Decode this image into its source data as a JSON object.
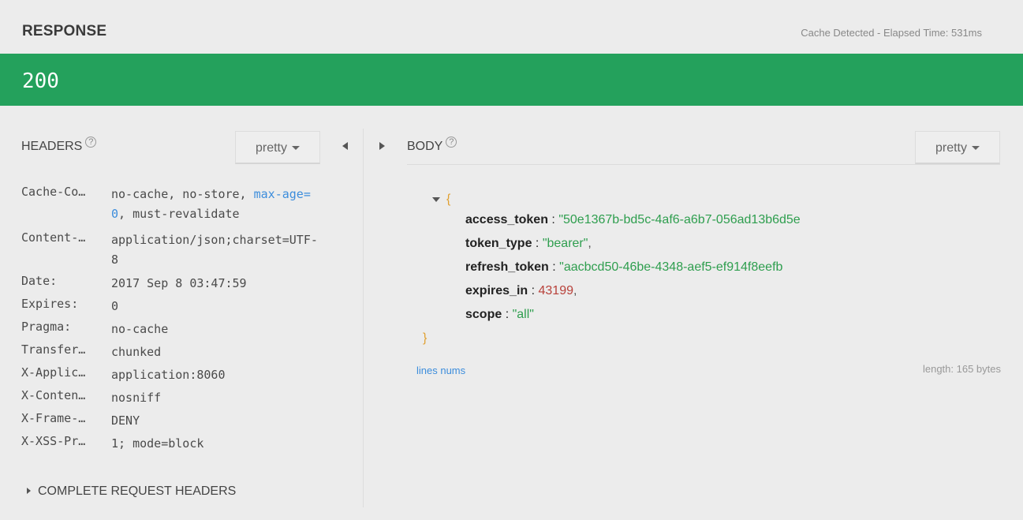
{
  "response": {
    "title": "RESPONSE",
    "cache_info": "Cache Detected - Elapsed Time: 531ms",
    "status_code": "200",
    "status_color": "#24a15c"
  },
  "headers_panel": {
    "title": "HEADERS",
    "help_icon": "?",
    "format": "pretty",
    "rows": [
      {
        "key": "Cache-Co…",
        "value": "no-cache, no-store, ",
        "value_blue": "max-age=0",
        "value_tail": ", must-revalidate"
      },
      {
        "key": "Content-…",
        "value": "application/json;charset=UTF-8"
      },
      {
        "key": "Date:",
        "value": "2017 Sep 8 03:47:59"
      },
      {
        "key": "Expires:",
        "value": "0"
      },
      {
        "key": "Pragma:",
        "value": "no-cache"
      },
      {
        "key": "Transfer…",
        "value": "chunked"
      },
      {
        "key": "X-Applic…",
        "value": "application:8060"
      },
      {
        "key": "X-Conten…",
        "value": "nosniff"
      },
      {
        "key": "X-Frame-…",
        "value": "DENY"
      },
      {
        "key": "X-XSS-Pr…",
        "value": "1; mode=block"
      }
    ],
    "complete_request_headers": "COMPLETE REQUEST HEADERS"
  },
  "body_panel": {
    "title": "BODY",
    "help_icon": "?",
    "format": "pretty",
    "open_brace": "{",
    "close_brace": "}",
    "fields": [
      {
        "key": "access_token",
        "value": "\"50e1367b-bd5c-4af6-a6b7-056ad13b6d5e",
        "type": "string"
      },
      {
        "key": "token_type",
        "value": "\"bearer\"",
        "type": "string",
        "comma": ","
      },
      {
        "key": "refresh_token",
        "value": "\"aacbcd50-46be-4348-aef5-ef914f8eefb",
        "type": "string"
      },
      {
        "key": "expires_in",
        "value": "43199",
        "type": "number",
        "comma": ","
      },
      {
        "key": "scope",
        "value": "\"all\"",
        "type": "string"
      }
    ],
    "lines_nums": "lines nums",
    "length": "length: 165 bytes"
  }
}
